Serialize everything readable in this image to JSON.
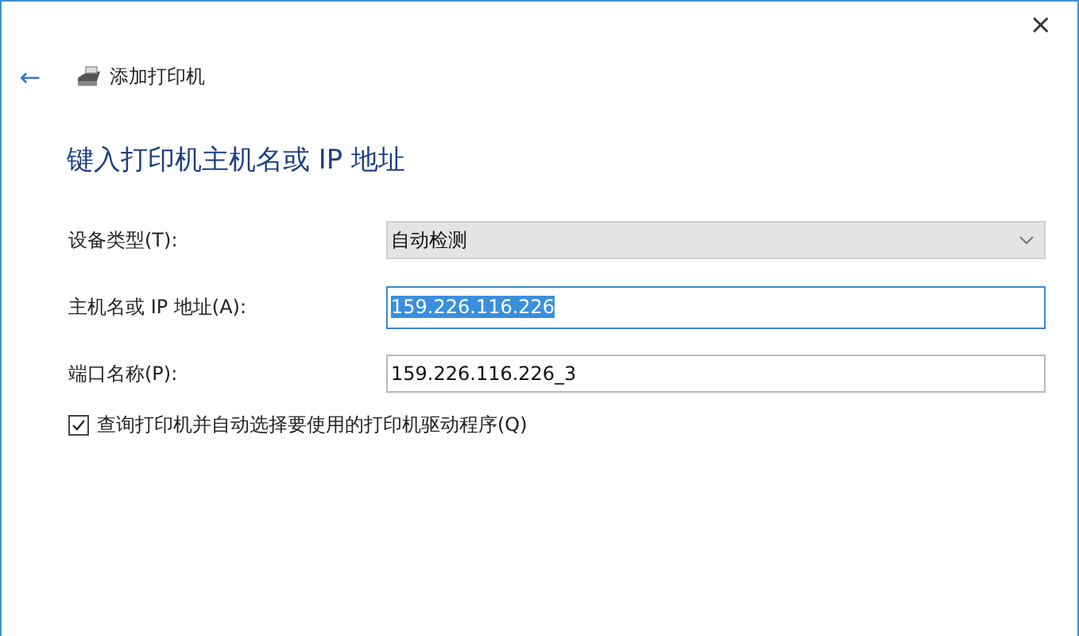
{
  "window": {
    "close": "×"
  },
  "header": {
    "back": "←",
    "title": "添加打印机"
  },
  "heading": "键入打印机主机名或 IP 地址",
  "fields": [
    {
      "label": "设备类型(T):",
      "kind": "select",
      "value": "自动检测",
      "focused": false
    },
    {
      "label": "主机名或 IP 地址(A):",
      "kind": "text",
      "value": "159.226.116.226",
      "focused": true
    },
    {
      "label": "端口名称(P):",
      "kind": "text",
      "value": "159.226.116.226_3",
      "focused": false
    }
  ],
  "checkbox": {
    "label": "查询打印机并自动选择要使用的打印机驱动程序(Q)",
    "checked": true
  }
}
